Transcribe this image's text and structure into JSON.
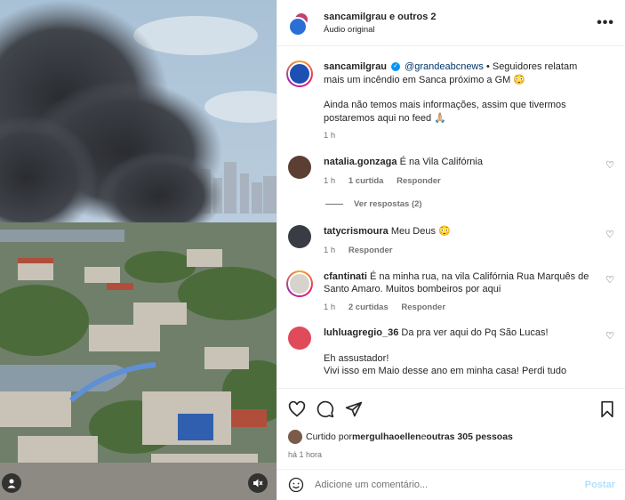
{
  "header": {
    "title": "sancamilgrau e outros 2",
    "subtitle": "Áudio original"
  },
  "caption": {
    "username": "sancamilgrau",
    "mention": "@grandeabcnews",
    "text1": " • Seguidores relatam mais um incêndio em Sanca próximo a GM 😳",
    "text2": "Ainda não temos mais informações, assim que tivermos postaremos aqui no feed 🙏🏼",
    "time": "1 h"
  },
  "comments": [
    {
      "username": "natalia.gonzaga",
      "text": "É na Vila Califórnia",
      "time": "1 h",
      "likes": "1 curtida",
      "reply": "Responder",
      "view_replies": "Ver respostas (2)"
    },
    {
      "username": "tatycrismoura",
      "text": "Meu Deus 😳",
      "time": "1 h",
      "reply": "Responder"
    },
    {
      "username": "cfantinati",
      "text": "É na minha rua, na vila Califórnia Rua Marquês de Santo Amaro. Muitos bombeiros por aqui",
      "time": "1 h",
      "likes": "2 curtidas",
      "reply": "Responder"
    },
    {
      "username": "luhluagregio_36",
      "text": "Da pra ver aqui do Pq São Lucas!",
      "text2": "Eh assustador!",
      "text3": "Vivi isso em Maio desse ano em minha casa! Perdi tudo"
    }
  ],
  "likes_bar": {
    "prefix": "Curtido por ",
    "user": "mergulhaoellen",
    "middle": " e ",
    "others": "outras 305 pessoas",
    "time": "há 1 hora"
  },
  "add_comment": {
    "placeholder": "Adicione um comentário...",
    "post_label": "Postar"
  },
  "icons": [
    "heart-icon",
    "comment-icon",
    "share-icon",
    "bookmark-icon",
    "emoji-icon",
    "more-icon",
    "mute-icon",
    "user-tag-icon"
  ]
}
